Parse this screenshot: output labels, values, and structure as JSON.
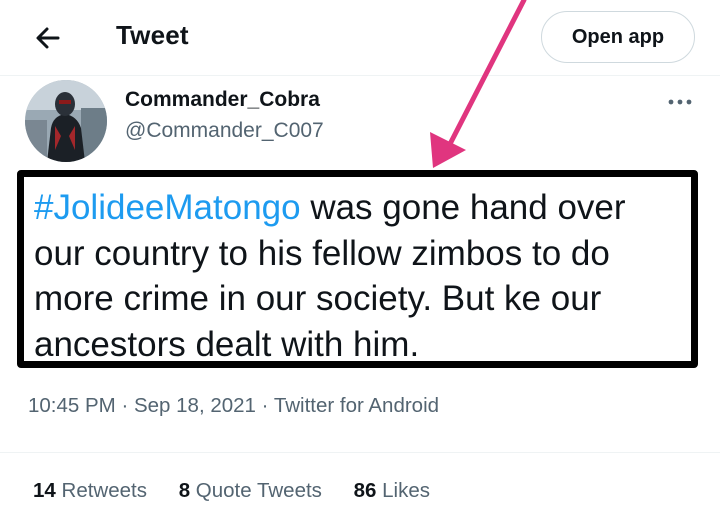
{
  "header": {
    "title": "Tweet",
    "open_app_label": "Open app"
  },
  "author": {
    "name": "Commander_Cobra",
    "handle": "@Commander_C007"
  },
  "tweet": {
    "hashtag": "#JolideeMatongo",
    "text": " was gone hand over our country to his fellow zimbos to do more crime in our society. But ke our ancestors dealt with him."
  },
  "meta": {
    "time": "10:45 PM",
    "sep1": " · ",
    "date": "Sep 18, 2021",
    "sep2": " · ",
    "source": "Twitter for Android"
  },
  "stats": {
    "retweets_count": "14",
    "retweets_label": "Retweets",
    "quotes_count": "8",
    "quotes_label": "Quote Tweets",
    "likes_count": "86",
    "likes_label": "Likes"
  },
  "colors": {
    "link": "#1d9bf0",
    "secondary_text": "#536471",
    "annotation_arrow": "#e0357f"
  },
  "icons": {
    "back": "arrow-left-icon",
    "more": "more-dots-icon"
  }
}
